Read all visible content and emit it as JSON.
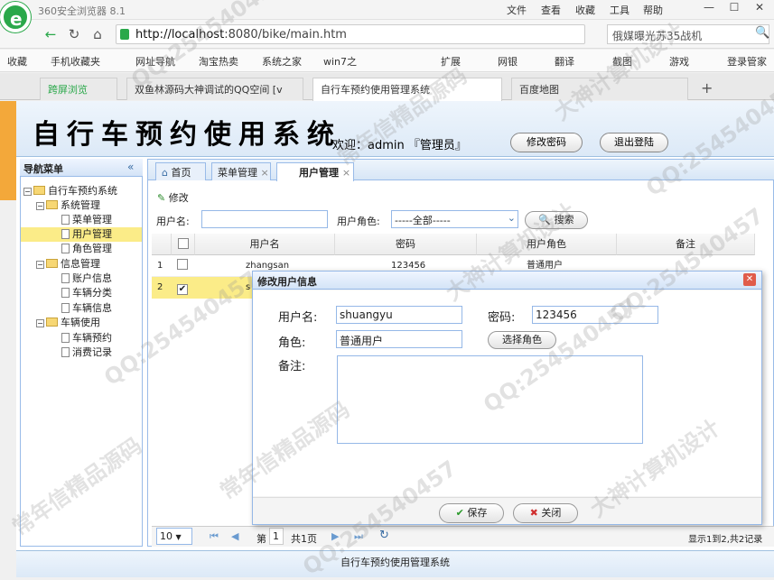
{
  "browser": {
    "app_name": "360安全浏览器 8.1",
    "menu": [
      "文件",
      "查看",
      "收藏",
      "工具",
      "帮助"
    ],
    "url_host": "http://localhost",
    "url_port": ":8080/bike/main.htm",
    "search_text": "俄媒曝光苏35战机",
    "bookmarks": [
      "收藏",
      "手机收藏夹",
      "网址导航",
      "淘宝热卖",
      "系统之家",
      "win7之",
      "扩展",
      "网银",
      "翻译",
      "截图",
      "游戏",
      "登录管家"
    ],
    "tabs": [
      "跨屏浏览",
      "双鱼林源码大神调试的QQ空间 [v",
      "自行车预约使用管理系统",
      "百度地图"
    ]
  },
  "app": {
    "title": "自行车预约使用系统",
    "welcome": "欢迎：admin 『管理员』",
    "change_pwd_label": "修改密码",
    "logout_label": "退出登陆",
    "footer": "自行车预约使用管理系统"
  },
  "nav": {
    "header": "导航菜单",
    "items": [
      {
        "label": "自行车预约系统",
        "type": "root"
      },
      {
        "label": "系统管理",
        "type": "folder"
      },
      {
        "label": "菜单管理",
        "type": "leaf"
      },
      {
        "label": "用户管理",
        "type": "leaf",
        "selected": true
      },
      {
        "label": "角色管理",
        "type": "leaf"
      },
      {
        "label": "信息管理",
        "type": "folder"
      },
      {
        "label": "账户信息",
        "type": "leaf"
      },
      {
        "label": "车辆分类",
        "type": "leaf"
      },
      {
        "label": "车辆信息",
        "type": "leaf"
      },
      {
        "label": "车辆使用",
        "type": "folder"
      },
      {
        "label": "车辆预约",
        "type": "leaf"
      },
      {
        "label": "消费记录",
        "type": "leaf"
      }
    ]
  },
  "content_tabs": [
    "首页",
    "菜单管理",
    "用户管理"
  ],
  "toolbar": {
    "edit_label": "修改",
    "username_label": "用户名:",
    "role_label": "用户角色:",
    "role_value": "-----全部-----",
    "search_label": "搜索"
  },
  "grid": {
    "headers": [
      "用户名",
      "密码",
      "用户角色",
      "备注"
    ],
    "rows": [
      {
        "num": "1",
        "username": "zhangsan",
        "password": "123456",
        "role": "普通用户",
        "note": ""
      },
      {
        "num": "2",
        "username": "s",
        "password": "",
        "role": "",
        "note": ""
      }
    ]
  },
  "pager": {
    "page_size": "10",
    "page_label": "第",
    "page_num": "1",
    "total_pages": "共1页",
    "summary": "显示1到2,共2记录"
  },
  "dialog": {
    "title": "修改用户信息",
    "username_label": "用户名:",
    "username_value": "shuangyu",
    "password_label": "密码:",
    "password_value": "123456",
    "role_label": "角色:",
    "role_value": "普通用户",
    "choose_role_label": "选择角色",
    "note_label": "备注:",
    "save_label": "保存",
    "close_label": "关闭"
  },
  "watermarks": [
    "QQ:254540457",
    "大神计算机设计",
    "常年信精品源码",
    "QQ:254540457",
    "大神计算机设计",
    "QQ:254540457",
    "常年信精品源码",
    "QQ:254540457",
    "大神计算机设计",
    "QQ:254540457",
    "常年信精品源码",
    "QQ:254540457"
  ]
}
